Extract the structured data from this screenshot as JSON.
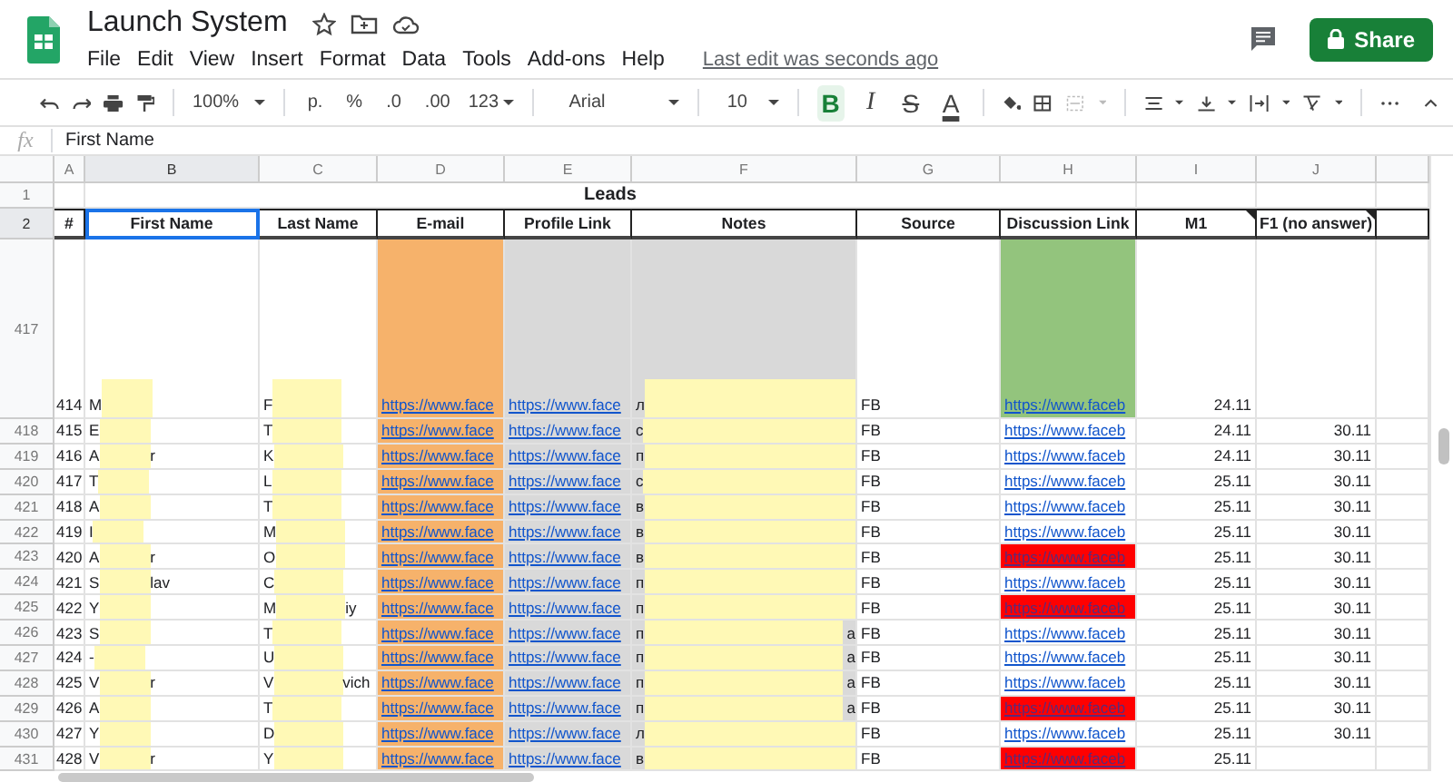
{
  "app": {
    "title": "Launch System",
    "menus": [
      "File",
      "Edit",
      "View",
      "Insert",
      "Format",
      "Data",
      "Tools",
      "Add-ons",
      "Help"
    ],
    "last_edit": "Last edit was seconds ago",
    "share": "Share"
  },
  "toolbar": {
    "zoom": "100%",
    "number_formats": [
      "p.",
      "%",
      ".0",
      ".00",
      "123"
    ],
    "font": "Arial",
    "font_size": "10",
    "text_styles": [
      {
        "label": "B",
        "kind": "bold",
        "selected": true
      },
      {
        "label": "I",
        "kind": "italic",
        "selected": false
      },
      {
        "label": "S",
        "kind": "strike",
        "selected": false
      },
      {
        "label": "A",
        "kind": "color",
        "selected": false
      }
    ]
  },
  "formula_bar": {
    "fx": "fx",
    "value": "First Name"
  },
  "sheet": {
    "column_letters": [
      "A",
      "B",
      "C",
      "D",
      "E",
      "F",
      "G",
      "H",
      "I",
      "J"
    ],
    "title_row": {
      "row_number": "1",
      "title": "Leads"
    },
    "header_row": {
      "row_number": "2",
      "cells": [
        {
          "label": "#",
          "selected": false,
          "has_note": false
        },
        {
          "label": "First Name",
          "selected": true,
          "has_note": false
        },
        {
          "label": "Last Name",
          "selected": false,
          "has_note": false
        },
        {
          "label": "E-mail",
          "selected": false,
          "has_note": false
        },
        {
          "label": "Profile Link",
          "selected": false,
          "has_note": false
        },
        {
          "label": "Notes",
          "selected": false,
          "has_note": false
        },
        {
          "label": "Source",
          "selected": false,
          "has_note": false
        },
        {
          "label": "Discussion Link",
          "selected": false,
          "has_note": false
        },
        {
          "label": "M1",
          "selected": false,
          "has_note": true
        },
        {
          "label": "F1 (no answer)",
          "selected": false,
          "has_note": true
        }
      ]
    },
    "rows": [
      {
        "row_number": "417",
        "tall": true,
        "number": "414",
        "first_name_start": "M",
        "last_name_start": "F",
        "email": "https://www.face",
        "profile": "https://www.face",
        "notes_start": "л",
        "source": "FB",
        "discussion": "https://www.faceb",
        "highlighted": true,
        "flagged": false,
        "m1": "24.11"
      },
      {
        "row_number": "418",
        "tall": false,
        "number": "415",
        "first_name_start": "E",
        "last_name_start": "T",
        "email": "https://www.face",
        "profile": "https://www.face",
        "notes_start": "с",
        "source": "FB",
        "discussion": "https://www.faceb",
        "highlighted": false,
        "flagged": false,
        "m1": "24.11",
        "f1": "30.11"
      },
      {
        "row_number": "419",
        "tall": false,
        "number": "416",
        "first_name_start": "A",
        "first_name_end": "r",
        "last_name_start": "K",
        "email": "https://www.face",
        "profile": "https://www.face",
        "notes_start": "п",
        "source": "FB",
        "discussion": "https://www.faceb",
        "highlighted": false,
        "flagged": false,
        "m1": "24.11",
        "f1": "30.11"
      },
      {
        "row_number": "420",
        "tall": false,
        "number": "417",
        "first_name_start": "T",
        "last_name_start": "L",
        "email": "https://www.face",
        "profile": "https://www.face",
        "notes_start": "с",
        "source": "FB",
        "discussion": "https://www.faceb",
        "highlighted": false,
        "flagged": false,
        "m1": "25.11",
        "f1": "30.11"
      },
      {
        "row_number": "421",
        "tall": false,
        "number": "418",
        "first_name_start": "A",
        "last_name_start": "T",
        "email": "https://www.face",
        "profile": "https://www.face",
        "notes_start": "в",
        "source": "FB",
        "discussion": "https://www.faceb",
        "highlighted": false,
        "flagged": false,
        "m1": "25.11",
        "f1": "30.11"
      },
      {
        "row_number": "422",
        "tall": false,
        "number": "419",
        "first_name_start": "I",
        "last_name_start": "M",
        "email": "https://www.face",
        "profile": "https://www.face",
        "notes_start": "в",
        "source": "FB",
        "discussion": "https://www.faceb",
        "highlighted": false,
        "flagged": false,
        "m1": "25.11",
        "f1": "30.11"
      },
      {
        "row_number": "423",
        "tall": false,
        "number": "420",
        "first_name_start": "A",
        "first_name_end": "r",
        "last_name_start": "O",
        "email": "https://www.face",
        "profile": "https://www.face",
        "notes_start": "в",
        "source": "FB",
        "discussion": "https://www.faceb",
        "highlighted": false,
        "flagged": true,
        "m1": "25.11",
        "f1": "30.11"
      },
      {
        "row_number": "424",
        "tall": false,
        "number": "421",
        "first_name_start": "S",
        "first_name_end": "lav",
        "last_name_start": "C",
        "email": "https://www.face",
        "profile": "https://www.face",
        "notes_start": "п",
        "source": "FB",
        "discussion": "https://www.faceb",
        "highlighted": false,
        "flagged": false,
        "m1": "25.11",
        "f1": "30.11"
      },
      {
        "row_number": "425",
        "tall": false,
        "number": "422",
        "first_name_start": "Y",
        "last_name_start": "M",
        "last_name_end": "iy",
        "email": "https://www.face",
        "profile": "https://www.face",
        "notes_start": "п",
        "source": "FB",
        "discussion": "https://www.faceb",
        "highlighted": false,
        "flagged": true,
        "m1": "25.11",
        "f1": "30.11"
      },
      {
        "row_number": "426",
        "tall": false,
        "number": "423",
        "first_name_start": "S",
        "last_name_start": "T",
        "email": "https://www.face",
        "profile": "https://www.face",
        "notes_start": "п",
        "notes_end": "а",
        "source": "FB",
        "discussion": "https://www.faceb",
        "highlighted": false,
        "flagged": false,
        "m1": "25.11",
        "f1": "30.11"
      },
      {
        "row_number": "427",
        "tall": false,
        "number": "424",
        "first_name_start": "-",
        "last_name_start": "U",
        "email": "https://www.face",
        "profile": "https://www.face",
        "notes_start": "п",
        "notes_end": "а",
        "source": "FB",
        "discussion": "https://www.faceb",
        "highlighted": false,
        "flagged": false,
        "m1": "25.11",
        "f1": "30.11"
      },
      {
        "row_number": "428",
        "tall": false,
        "number": "425",
        "first_name_start": "V",
        "first_name_end": "r",
        "last_name_start": "V",
        "last_name_end": "vich",
        "email": "https://www.face",
        "profile": "https://www.face",
        "notes_start": "п",
        "notes_end": "а",
        "source": "FB",
        "discussion": "https://www.faceb",
        "highlighted": false,
        "flagged": false,
        "m1": "25.11",
        "f1": "30.11"
      },
      {
        "row_number": "429",
        "tall": false,
        "number": "426",
        "first_name_start": "A",
        "last_name_start": "T",
        "email": "https://www.face",
        "profile": "https://www.face",
        "notes_start": "п",
        "notes_end": "а",
        "source": "FB",
        "discussion": "https://www.faceb",
        "highlighted": false,
        "flagged": true,
        "m1": "25.11",
        "f1": "30.11"
      },
      {
        "row_number": "430",
        "tall": false,
        "number": "427",
        "first_name_start": "Y",
        "last_name_start": "D",
        "email": "https://www.face",
        "profile": "https://www.face",
        "notes_start": "л",
        "source": "FB",
        "discussion": "https://www.faceb",
        "highlighted": false,
        "flagged": false,
        "m1": "25.11",
        "f1": "30.11"
      },
      {
        "row_number": "431",
        "tall": false,
        "number": "428",
        "first_name_start": "V",
        "first_name_end": "r",
        "last_name_start": "Y",
        "email": "https://www.face",
        "profile": "https://www.face",
        "notes_start": "в",
        "source": "FB",
        "discussion": "https://www.faceb",
        "highlighted": false,
        "flagged": true,
        "m1": "25.11"
      }
    ]
  }
}
